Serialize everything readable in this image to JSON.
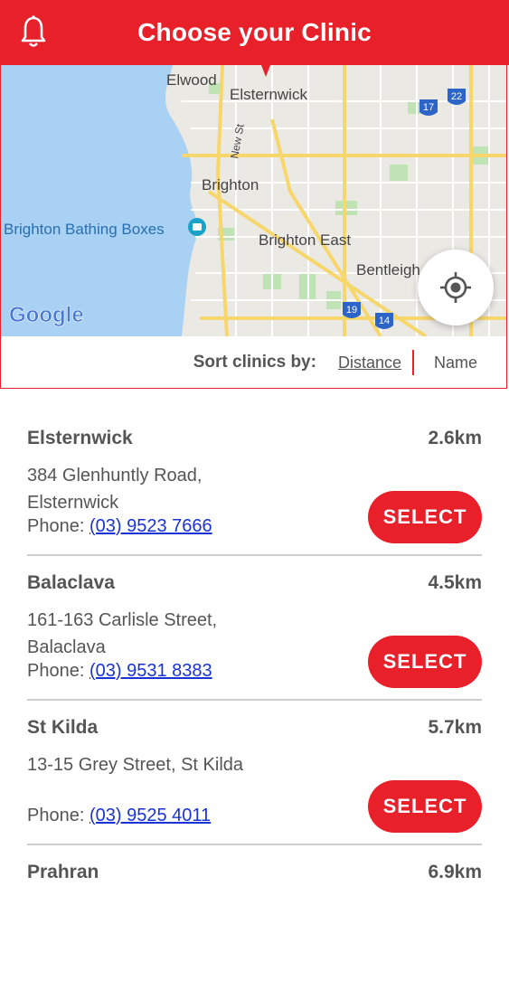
{
  "header": {
    "title": "Choose your Clinic",
    "icon": "bell-icon"
  },
  "map": {
    "labels": {
      "elwood": "Elwood",
      "elsternwick": "Elsternwick",
      "new_st": "New St",
      "brighton": "Brighton",
      "bathing_boxes": "Brighton Bathing Boxes",
      "brighton_east": "Brighton East",
      "bentleigh": "Bentleigh",
      "google": "Google"
    },
    "route_shields": [
      "17",
      "22",
      "19",
      "14"
    ]
  },
  "sort": {
    "label": "Sort clinics by:",
    "distance": "Distance",
    "name": "Name"
  },
  "clinics": [
    {
      "name": "Elsternwick",
      "distance": "2.6km",
      "address": "384 Glenhuntly Road, Elsternwick",
      "phone_label": "Phone:",
      "phone": "(03) 9523 7666",
      "select": "SELECT"
    },
    {
      "name": "Balaclava",
      "distance": "4.5km",
      "address": "161-163 Carlisle Street, Balaclava",
      "phone_label": "Phone:",
      "phone": "(03) 9531 8383",
      "select": "SELECT"
    },
    {
      "name": "St Kilda",
      "distance": "5.7km",
      "address": "13-15 Grey Street, St Kilda",
      "phone_label": "Phone:",
      "phone": "(03) 9525 4011",
      "select": "SELECT"
    },
    {
      "name": "Prahran",
      "distance": "6.9km"
    }
  ],
  "colors": {
    "brand_red": "#e8202a",
    "link_blue": "#1a33d6",
    "water": "#a8d1f4"
  }
}
